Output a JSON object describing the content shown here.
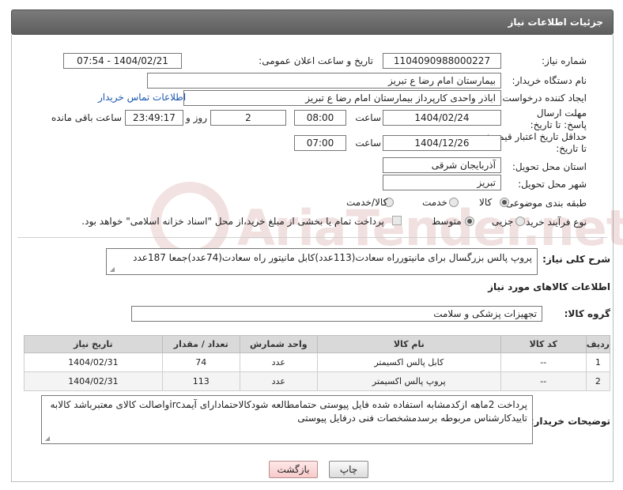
{
  "header": {
    "title": "جزئیات اطلاعات نیاز"
  },
  "form": {
    "need_number_label": "شماره نیاز:",
    "need_number": "1104090988000227",
    "announce_label": "تاریخ و ساعت اعلان عمومی:",
    "announce_value": "1404/02/21 - 07:54",
    "buyer_org_label": "نام دستگاه خریدار:",
    "buyer_org": "بیمارستان امام رضا  ع  تبریز",
    "creator_label": "ایجاد کننده درخواست:",
    "creator": "اباذر واحدی کارپرداز بیمارستان امام رضا  ع  تبریز",
    "contact_link": "اطلاعات تماس خریدار",
    "reply_deadline_label": "مهلت ارسال پاسخ: تا تاریخ:",
    "reply_date": "1404/02/24",
    "time_label": "ساعت",
    "reply_time": "08:00",
    "days_value": "2",
    "days_label": "روز و",
    "remaining_time": "23:49:17",
    "remaining_label": "ساعت باقی مانده",
    "min_valid_label": "حداقل تاریخ اعتبار قیمت: تا تاریخ:",
    "valid_date": "1404/12/26",
    "valid_time": "07:00",
    "province_label": "استان محل تحویل:",
    "province": "آذربایجان شرقی",
    "city_label": "شهر محل تحویل:",
    "city": "تبریز",
    "category_label": "طبقه بندی موضوعی:",
    "category_options": [
      "کالا",
      "خدمت",
      "کالا/خدمت"
    ],
    "category_selected": "کالا",
    "purchase_type_label": "نوع فرآیند خرید :",
    "purchase_options": [
      "جزیی",
      "متوسط"
    ],
    "purchase_selected": "متوسط",
    "payment_note": "پرداخت تمام یا بخشی از مبلغ خرید،از محل \"اسناد خزانه اسلامی\" خواهد بود.",
    "summary_label": "شرح کلی نیاز:",
    "summary": "پروپ پالس بزرگسال برای مانیتورراه سعادت(113عدد)کابل مانیتور راه سعادت(74عدد)جمعا 187عدد"
  },
  "goods_section": {
    "title": "اطلاعات کالاهای مورد نیاز",
    "group_label": "گروه کالا:",
    "group_value": "تجهیزات پزشکی و سلامت",
    "columns": [
      "ردیف",
      "کد کالا",
      "نام کالا",
      "واحد شمارش",
      "تعداد / مقدار",
      "تاریخ نیاز"
    ],
    "rows": [
      [
        "1",
        "--",
        "کابل پالس اکسیمتر",
        "عدد",
        "74",
        "1404/02/31"
      ],
      [
        "2",
        "--",
        "پروپ پالس اکسیمتر",
        "عدد",
        "113",
        "1404/02/31"
      ]
    ]
  },
  "buyer_notes": {
    "label": "توضیحات خریدار:",
    "text": "پرداخت 2ماهه ازکدمشابه استفاده شده فایل پیوستی حتمامطالعه شودکالاحتمادارای آیمدircواصالت کالای معتبرباشد کالابه تاییدکارشناس مربوطه برسدمشخصات فنی درفایل پیوستی"
  },
  "buttons": {
    "print": "چاپ",
    "back": "بازگشت"
  },
  "watermark": {
    "text": "AriaTender.net"
  }
}
